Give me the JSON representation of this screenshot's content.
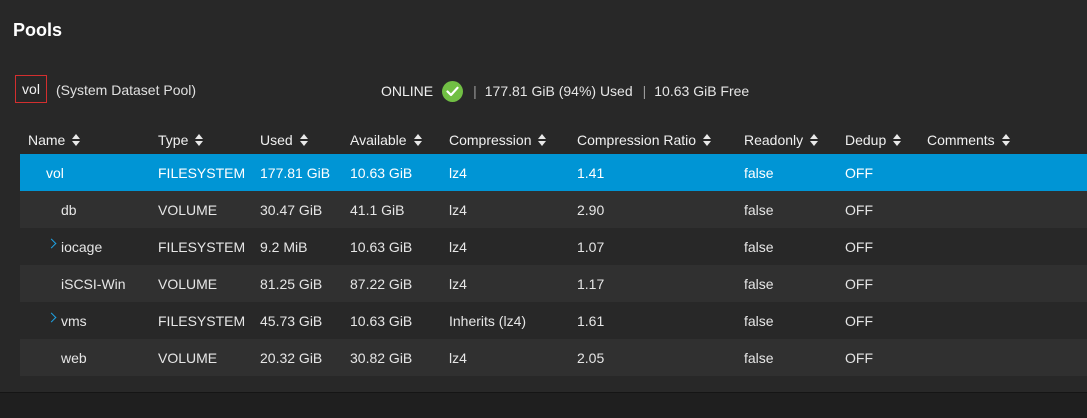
{
  "page": {
    "title": "Pools"
  },
  "pool": {
    "name": "vol",
    "description": "(System Dataset Pool)",
    "status": "ONLINE",
    "status_icon": "check-circle-icon",
    "used": "177.81 GiB (94%) Used",
    "free": "10.63 GiB Free",
    "separator": "|"
  },
  "colors": {
    "selected_row": "#0095d5",
    "ok_green": "#71bf44",
    "highlight_border": "#d32f2f"
  },
  "table": {
    "columns": [
      "Name",
      "Type",
      "Used",
      "Available",
      "Compression",
      "Compression Ratio",
      "Readonly",
      "Dedup",
      "Comments"
    ],
    "rows": [
      {
        "name": "vol",
        "type": "FILESYSTEM",
        "used": "177.81 GiB",
        "available": "10.63 GiB",
        "compression": "lz4",
        "ratio": "1.41",
        "readonly": "false",
        "dedup": "OFF",
        "comments": ""
      },
      {
        "name": "db",
        "type": "VOLUME",
        "used": "30.47 GiB",
        "available": "41.1 GiB",
        "compression": "lz4",
        "ratio": "2.90",
        "readonly": "false",
        "dedup": "OFF",
        "comments": ""
      },
      {
        "name": "iocage",
        "type": "FILESYSTEM",
        "used": "9.2 MiB",
        "available": "10.63 GiB",
        "compression": "lz4",
        "ratio": "1.07",
        "readonly": "false",
        "dedup": "OFF",
        "comments": ""
      },
      {
        "name": "iSCSI-Win",
        "type": "VOLUME",
        "used": "81.25 GiB",
        "available": "87.22 GiB",
        "compression": "lz4",
        "ratio": "1.17",
        "readonly": "false",
        "dedup": "OFF",
        "comments": ""
      },
      {
        "name": "vms",
        "type": "FILESYSTEM",
        "used": "45.73 GiB",
        "available": "10.63 GiB",
        "compression": "Inherits (lz4)",
        "ratio": "1.61",
        "readonly": "false",
        "dedup": "OFF",
        "comments": ""
      },
      {
        "name": "web",
        "type": "VOLUME",
        "used": "20.32 GiB",
        "available": "30.82 GiB",
        "compression": "lz4",
        "ratio": "2.05",
        "readonly": "false",
        "dedup": "OFF",
        "comments": ""
      }
    ]
  }
}
